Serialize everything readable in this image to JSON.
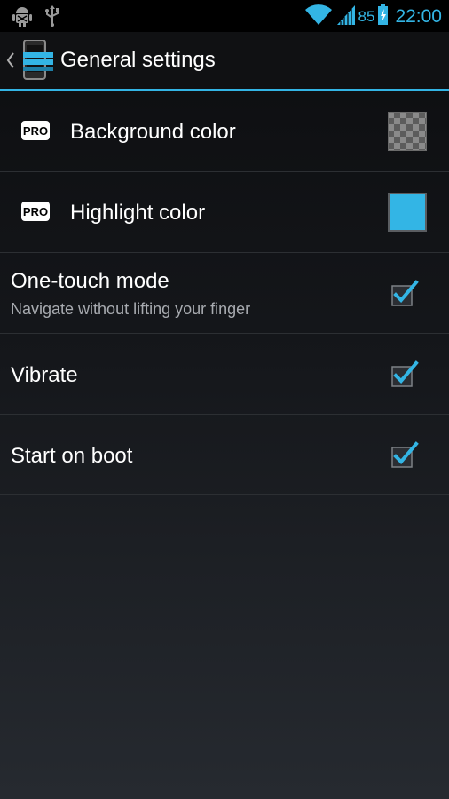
{
  "status_bar": {
    "left_icons": [
      "android-debug-icon",
      "usb-icon"
    ],
    "right_icons": [
      "wifi-icon",
      "signal-icon",
      "battery-charging-icon"
    ],
    "battery_percent": "85",
    "clock": "22:00",
    "accent_color": "#33b5e5"
  },
  "action_bar": {
    "up_icon": "chevron-left-icon",
    "app_icon": "app-phone-icon",
    "title": "General settings",
    "accent_color": "#33b5e5"
  },
  "preferences": [
    {
      "badge": "PRO",
      "title": "Background color",
      "widget": "checker-swatch"
    },
    {
      "badge": "PRO",
      "title": "Highlight color",
      "widget": "color-swatch",
      "color": "#33b5e5"
    },
    {
      "title": "One-touch mode",
      "summary": "Navigate without lifting your finger",
      "widget": "checkbox",
      "checked": true
    },
    {
      "title": "Vibrate",
      "widget": "checkbox",
      "checked": true
    },
    {
      "title": "Start on boot",
      "widget": "checkbox",
      "checked": true
    }
  ]
}
